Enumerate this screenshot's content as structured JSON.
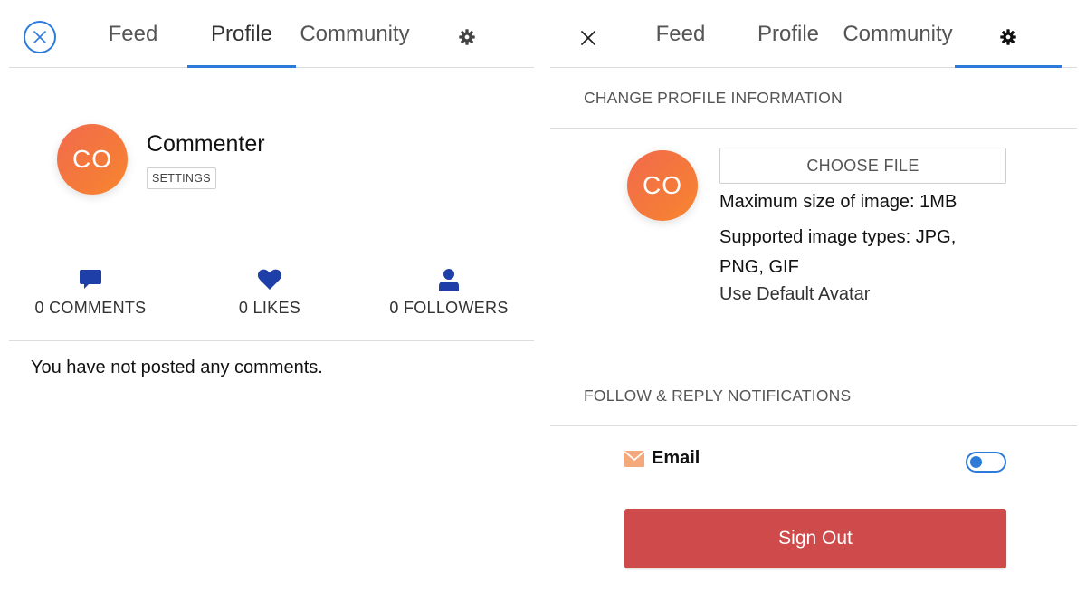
{
  "colors": {
    "accent": "#2c7bd9",
    "avatar_gradient_start": "#f26a4d",
    "avatar_gradient_end": "#f8862e",
    "icon_blue": "#1f3fa8",
    "danger": "#cf4a4a"
  },
  "left": {
    "tabs": {
      "feed": "Feed",
      "profile": "Profile",
      "community": "Community"
    },
    "active_tab": "Profile",
    "avatar_initials": "CO",
    "username": "Commenter",
    "settings_label": "SETTINGS",
    "stats": {
      "comments": {
        "icon": "comment-icon",
        "label": "0 COMMENTS"
      },
      "likes": {
        "icon": "heart-icon",
        "label": "0 LIKES"
      },
      "followers": {
        "icon": "user-icon",
        "label": "0 FOLLOWERS"
      }
    },
    "empty_message": "You have not posted any comments."
  },
  "right": {
    "tabs": {
      "feed": "Feed",
      "profile": "Profile",
      "community": "Community"
    },
    "active_tab": "settings",
    "change_profile_header": "CHANGE PROFILE INFORMATION",
    "avatar_initials": "CO",
    "choose_file_label": "CHOOSE FILE",
    "max_size_text": "Maximum size of image: 1MB",
    "supported_types_line1": "Supported image types: JPG,",
    "supported_types_line2": "PNG, GIF",
    "default_avatar_link": "Use Default Avatar",
    "notifications_header": "FOLLOW & REPLY NOTIFICATIONS",
    "email_label": "Email",
    "email_toggle_on": false,
    "sign_out_label": "Sign Out"
  }
}
